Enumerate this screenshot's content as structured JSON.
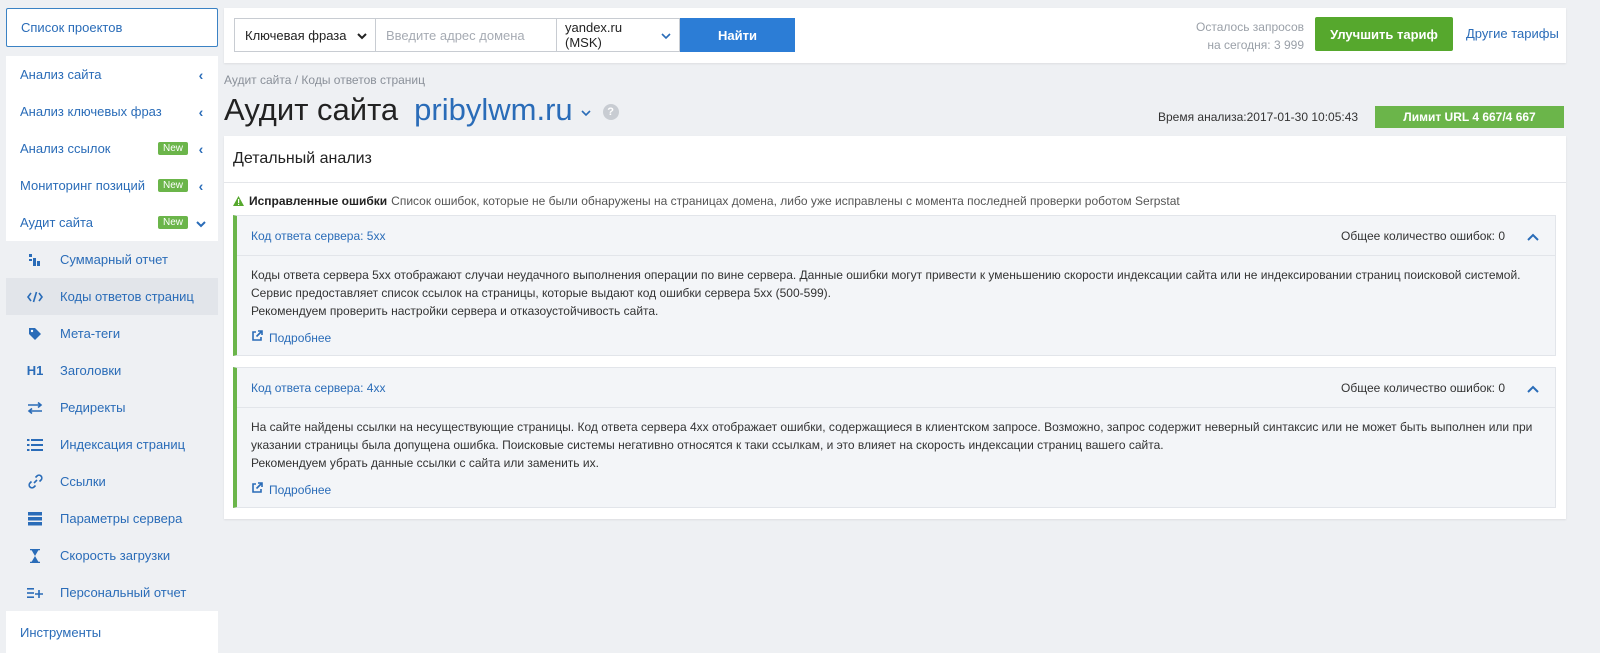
{
  "sidebar": {
    "projects_label": "Список проектов",
    "items": [
      {
        "label": "Анализ сайта",
        "badge": ""
      },
      {
        "label": "Анализ ключевых фраз",
        "badge": ""
      },
      {
        "label": "Анализ ссылок",
        "badge": "New"
      },
      {
        "label": "Мониторинг позиций",
        "badge": "New"
      },
      {
        "label": "Аудит сайта",
        "badge": "New"
      }
    ],
    "sub_items": [
      {
        "label": "Суммарный отчет",
        "icon": "summary-report-icon"
      },
      {
        "label": "Коды ответов страниц",
        "icon": "code-icon"
      },
      {
        "label": "Мета-теги",
        "icon": "tag-icon"
      },
      {
        "label": "Заголовки",
        "icon": "h1-icon",
        "glyph": "H1"
      },
      {
        "label": "Редиректы",
        "icon": "redirect-icon"
      },
      {
        "label": "Индексация страниц",
        "icon": "list-icon"
      },
      {
        "label": "Ссылки",
        "icon": "link-icon"
      },
      {
        "label": "Параметры сервера",
        "icon": "server-icon"
      },
      {
        "label": "Скорость загрузки",
        "icon": "hourglass-icon"
      },
      {
        "label": "Персональный отчет",
        "icon": "list-plus-icon"
      }
    ],
    "tools_label": "Инструменты"
  },
  "topbar": {
    "phrase_select": "Ключевая фраза",
    "domain_placeholder": "Введите адрес домена",
    "engine_select": "yandex.ru (MSK)",
    "find_label": "Найти",
    "requests_line1": "Осталось запросов",
    "requests_line2": "на сегодня: 3 999",
    "upgrade_label": "Улучшить тариф",
    "other_tariffs": "Другие тарифы"
  },
  "header": {
    "breadcrumb": "Аудит сайта / Коды ответов страниц",
    "title": "Аудит сайта",
    "domain": "pribylwm.ru",
    "analysis_time": "Время анализа:2017-01-30 10:05:43",
    "limit": "Лимит URL 4 667/4 667"
  },
  "panel": {
    "title": "Детальный анализ",
    "fixed_bold": "Исправленные ошибки",
    "fixed_text": "Список ошибок, которые не были обнаружены на страницах домена, либо уже исправлены с момента последней проверки роботом Serpstat",
    "blocks": [
      {
        "code": "Код ответа сервера: 5xx",
        "total": "Общее количество ошибок: 0",
        "text1": "Коды ответа сервера 5xx отображают случаи неудачного выполнения операции по вине сервера. Данные ошибки могут привести к уменьшению скорости индексации сайта или не индексировании страниц поисковой системой. Сервис предоставляет список ссылок на страницы, которые выдают код ошибки сервера 5xx (500-599).",
        "text2": "Рекомендуем проверить настройки сервера и отказоустойчивость сайта.",
        "more": "Подробнее"
      },
      {
        "code": "Код ответа сервера: 4xx",
        "total": "Общее количество ошибок: 0",
        "text1": "На сайте найдены ссылки на несуществующие страницы. Код ответа сервера 4xx отображает ошибки, содержащиеся в клиентском запросе. Возможно, запрос содержит неверный синтаксис или не может быть выполнен или при указании страницы была допущена ошибка. Поисковые системы негативно относятся к таки ссылкам, и это влияет на скорость индексации страниц вашего сайта.",
        "text2": "Рекомендуем убрать данные ссылки с сайта или заменить их.",
        "more": "Подробнее"
      }
    ]
  }
}
